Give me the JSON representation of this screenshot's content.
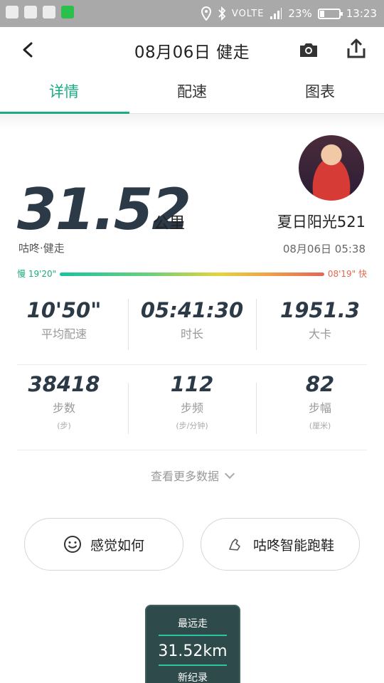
{
  "status_bar": {
    "network": "VOLTE",
    "battery": "23%",
    "battery_level": 0.23,
    "time": "13:23"
  },
  "nav": {
    "title": "08月06日 健走"
  },
  "tabs": [
    {
      "label": "详情",
      "active": true
    },
    {
      "label": "配速",
      "active": false
    },
    {
      "label": "图表",
      "active": false
    }
  ],
  "summary": {
    "distance": "31.52",
    "unit": "公里",
    "activity": "咕咚·健走",
    "username": "夏日阳光521",
    "datetime": "08月06日 05:38"
  },
  "pace_bar": {
    "slow_label": "慢 19'20\"",
    "fast_label": "08'19\" 快"
  },
  "stats": [
    {
      "value": "10'50\"",
      "label": "平均配速"
    },
    {
      "value": "05:41:30",
      "label": "时长"
    },
    {
      "value": "1951.3",
      "label": "大卡"
    },
    {
      "value": "38418",
      "label": "步数",
      "unit": "(步)"
    },
    {
      "value": "112",
      "label": "步频",
      "unit": "(步/分钟)"
    },
    {
      "value": "82",
      "label": "步幅",
      "unit": "(厘米)"
    }
  ],
  "more_data": "查看更多数据",
  "buttons": {
    "feeling": "感觉如何",
    "shoes": "咕咚智能跑鞋"
  },
  "badge": {
    "top": "最远走",
    "value": "31.52km",
    "bottom": "新纪录"
  },
  "colors": {
    "accent": "#1aac84",
    "stat_text": "#2c3a48",
    "pace_fast": "#e06a4e"
  },
  "icons": [
    "back-icon",
    "camera-icon",
    "share-icon",
    "smile-icon",
    "shoe-icon",
    "location-icon",
    "bluetooth-icon",
    "signal-icon"
  ]
}
